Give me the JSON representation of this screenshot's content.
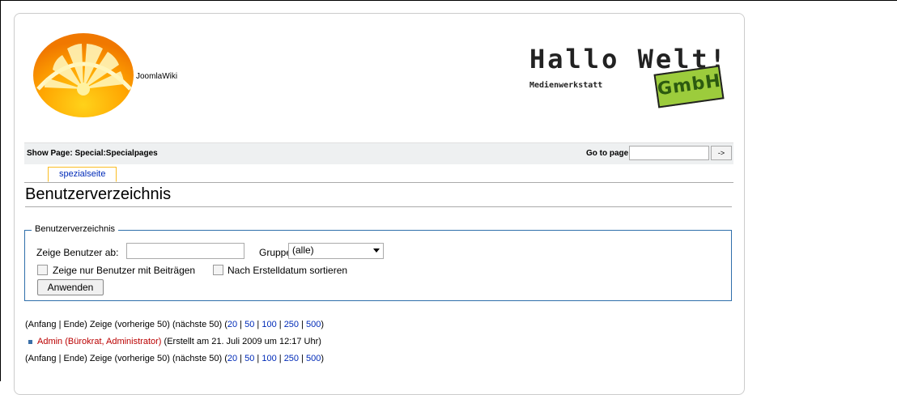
{
  "site": {
    "name": "JoomlaWiki"
  },
  "brand": {
    "title": "Hallo Welt!",
    "subtitle": "Medienwerkstatt",
    "badge": "GmbH"
  },
  "showbar": {
    "label": "Show Page: Special:Specialpages",
    "goto_label": "Go to page:",
    "goto_value": "",
    "goto_button": "->"
  },
  "tabs": [
    {
      "label": "spezialseite"
    }
  ],
  "page": {
    "title": "Benutzerverzeichnis"
  },
  "form": {
    "legend": "Benutzerverzeichnis",
    "from_label": "Zeige Benutzer ab:",
    "from_value": "",
    "group_label": "Gruppe:",
    "group_selected": "(alle)",
    "check_contrib_label": "Zeige nur Benutzer mit Beiträgen",
    "check_contrib": false,
    "check_sort_label": "Nach Erstelldatum sortieren",
    "check_sort": false,
    "submit_label": "Anwenden"
  },
  "pager": {
    "prefix": "(Anfang | Ende) Zeige (vorherige 50) (nächste 50) (",
    "limits": [
      "20",
      "50",
      "100",
      "250",
      "500"
    ],
    "sep": " | ",
    "suffix": ")"
  },
  "users": [
    {
      "name": "Admin",
      "groups": "Bürokrat, Administrator",
      "created": "(Erstellt am 21. Juli 2009 um 12:17 Uhr)"
    }
  ],
  "colors": {
    "link": "#002bb8",
    "redlink": "#ba0000",
    "fieldset_border": "#2f6fab",
    "tab_border": "#fabd23"
  }
}
